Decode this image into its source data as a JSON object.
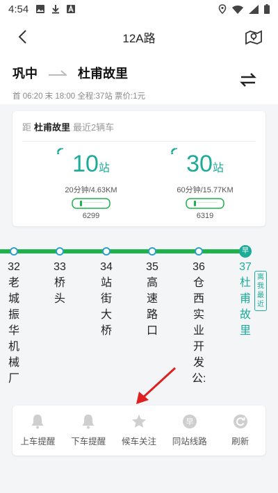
{
  "status": {
    "time": "4:54"
  },
  "nav": {
    "title": "12A路"
  },
  "route": {
    "from": "巩中",
    "to": "杜甫故里",
    "info": "首 06:20 末 18:00 全程:37站 票价:1元"
  },
  "card": {
    "prefix": "距",
    "destination": "杜甫故里",
    "suffix": "最近2辆车",
    "buses": [
      {
        "stations": "10",
        "unit": "站",
        "eta": "20分钟/4.63KM",
        "plate": "6299"
      },
      {
        "stations": "30",
        "unit": "站",
        "eta": "60分钟/15.77KM",
        "plate": "6319"
      }
    ]
  },
  "stops": [
    {
      "index": "32",
      "name": "老城振华机械厂"
    },
    {
      "index": "33",
      "name": "桥头"
    },
    {
      "index": "34",
      "name": "站街大桥"
    },
    {
      "index": "35",
      "name": "高速路口"
    },
    {
      "index": "36",
      "name": "仓西实业开发公:"
    },
    {
      "index": "37",
      "name": "杜甫故里"
    }
  ],
  "current_stop_marker": "早",
  "away_badge": "离我最近",
  "toolbar": [
    {
      "label": "上车提醒",
      "icon": "bell-icon"
    },
    {
      "label": "下车提醒",
      "icon": "bell-icon"
    },
    {
      "label": "候车关注",
      "icon": "star-icon"
    },
    {
      "label": "同站线路",
      "icon": "early-bus-icon"
    },
    {
      "label": "刷新",
      "icon": "refresh-icon"
    }
  ],
  "colors": {
    "accent": "#1cab98",
    "line": "#1db34b",
    "dot_border": "#2aa0c8",
    "annotation": "#e02020"
  }
}
